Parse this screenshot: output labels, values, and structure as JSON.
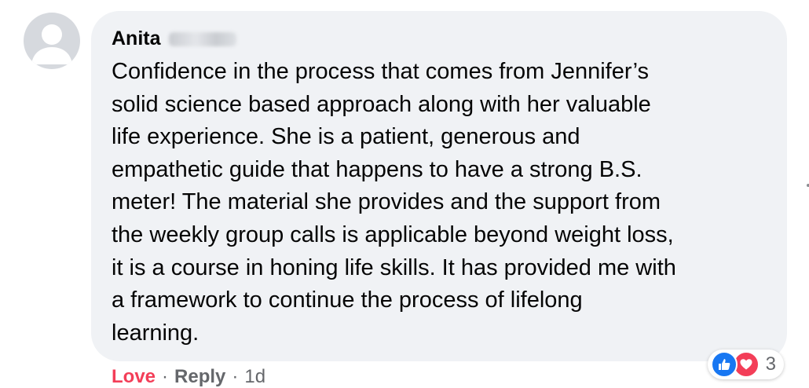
{
  "comment": {
    "author_first_name": "Anita",
    "text": "Confidence in the process that comes from Jennifer’s\nsolid science based approach along with her valuable\nlife experience. She is a patient, generous and\nempathetic guide that happens to have a strong B.S.\nmeter! The material she provides and the support from\nthe weekly group calls is applicable beyond weight loss,\nit is a course in honing life skills. It has provided me with\na framework to continue the process of lifelong\nlearning."
  },
  "actions": {
    "reaction_label": "Love",
    "separator": "·",
    "reply_label": "Reply",
    "timestamp": "1d"
  },
  "reactions": {
    "icons": [
      "like-icon",
      "love-icon"
    ],
    "count": "3"
  },
  "colors": {
    "bubble": "#f0f2f5",
    "love": "#f33e58",
    "like": "#1877f2",
    "meta": "#65676b"
  }
}
